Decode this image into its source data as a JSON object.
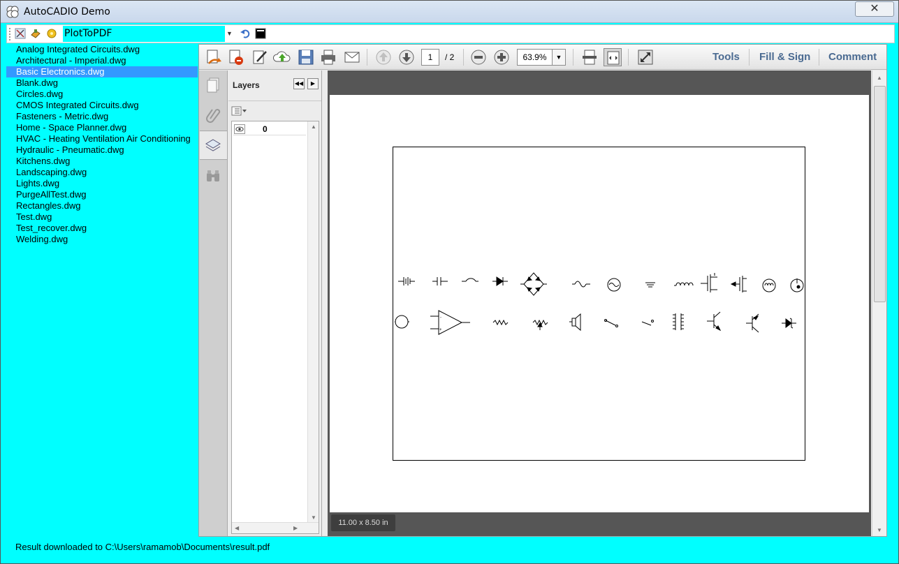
{
  "window": {
    "title": "AutoCADIO Demo",
    "close_symbol": "✕"
  },
  "topbar": {
    "selected_activity": "PlotToPDF"
  },
  "files": [
    "Analog Integrated Circuits.dwg",
    "Architectural - Imperial.dwg",
    "Basic Electronics.dwg",
    "Blank.dwg",
    "Circles.dwg",
    "CMOS Integrated Circuits.dwg",
    "Fasteners - Metric.dwg",
    "Home - Space Planner.dwg",
    "HVAC - Heating Ventilation Air Conditioning",
    "Hydraulic - Pneumatic.dwg",
    "Kitchens.dwg",
    "Landscaping.dwg",
    "Lights.dwg",
    "PurgeAllTest.dwg",
    "Rectangles.dwg",
    "Test.dwg",
    "Test_recover.dwg",
    "Welding.dwg"
  ],
  "selected_file_index": 2,
  "viewer": {
    "page_current": "1",
    "page_total": "/ 2",
    "zoom": "63.9%",
    "tabs": {
      "tools": "Tools",
      "fill_sign": "Fill & Sign",
      "comment": "Comment"
    },
    "layers_title": "Layers",
    "layer_name": "0",
    "page_size": "11.00 x 8.50 in"
  },
  "status": "Result downloaded to C:\\Users\\ramamob\\Documents\\result.pdf",
  "colors": {
    "background": "#00ffff",
    "selection": "#3399ff",
    "tab_text": "#4a6a91"
  }
}
